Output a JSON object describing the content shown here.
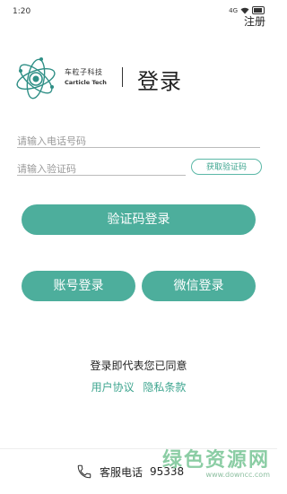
{
  "status": {
    "time": "1:20",
    "signal": "4G",
    "wifi_icon": "wifi-icon",
    "battery_icon": "battery-icon"
  },
  "header": {
    "register_label": "注册"
  },
  "brand": {
    "company_cn": "车粒子科技",
    "company_en": "Carticle Tech",
    "title": "登录",
    "logo_icon": "carticle-atom-logo"
  },
  "form": {
    "phone_placeholder": "请输入电话号码",
    "phone_value": "",
    "code_placeholder": "请输入验证码",
    "code_value": "",
    "get_code_label": "获取验证码"
  },
  "buttons": {
    "code_login": "验证码登录",
    "account_login": "账号登录",
    "wechat_login": "微信登录"
  },
  "agreement": {
    "text": "登录即代表您已同意",
    "user_agreement": "用户协议",
    "privacy_policy": "隐私条款"
  },
  "footer": {
    "support_label": "客服电话",
    "support_number": "95338",
    "phone_icon": "phone-icon"
  },
  "watermark": {
    "main": "绿色资源网",
    "url": "www.downcc.com"
  },
  "colors": {
    "accent": "#4dae9c",
    "link": "#3ea58f"
  }
}
